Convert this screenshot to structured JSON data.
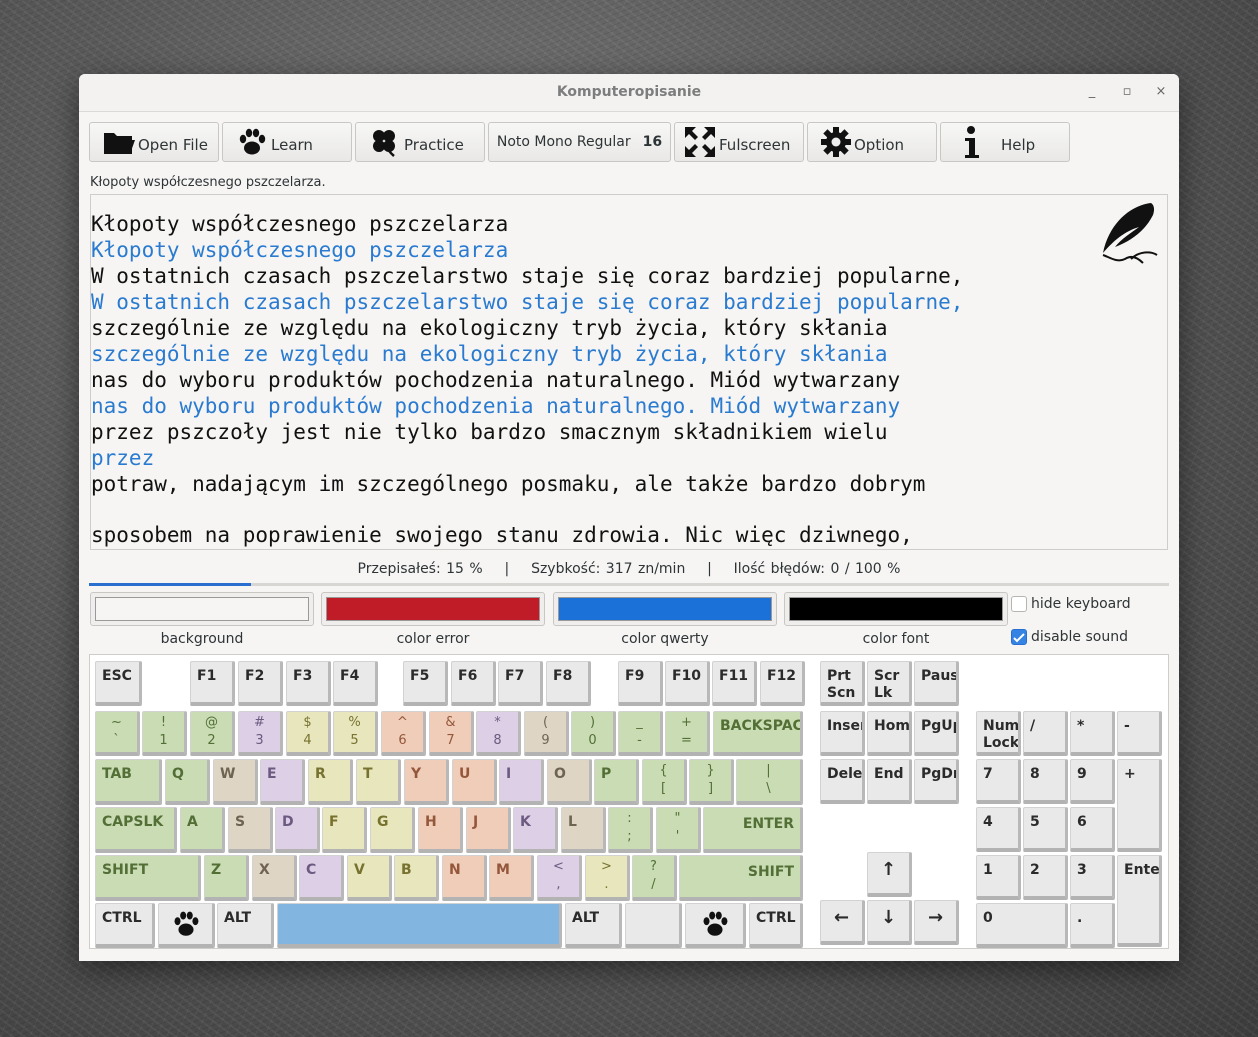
{
  "window": {
    "title": "Komputeropisanie",
    "controls": [
      "_",
      "▫",
      "×"
    ]
  },
  "toolbar": {
    "open": "Open File",
    "learn": "Learn",
    "practice": "Practice",
    "font_name": "Noto Mono Regular",
    "font_size": "16",
    "fullscreen": "Fulscreen",
    "option": "Option",
    "help": "Help"
  },
  "status_text": "Kłopoty współczesnego pszczelarza.",
  "text_lines": [
    {
      "kind": "original",
      "text": "Kłopoty współczesnego pszczelarza"
    },
    {
      "kind": "typed",
      "text": "Kłopoty współczesnego pszczelarza"
    },
    {
      "kind": "original",
      "text": "W ostatnich czasach pszczelarstwo staje się coraz bardziej popularne,"
    },
    {
      "kind": "typed",
      "text": "W ostatnich czasach pszczelarstwo staje się coraz bardziej popularne,"
    },
    {
      "kind": "original",
      "text": "szczególnie ze względu na ekologiczny tryb życia, który skłania"
    },
    {
      "kind": "typed",
      "text": "szczególnie ze względu na ekologiczny tryb życia, który skłania"
    },
    {
      "kind": "original",
      "text": "nas do wyboru produktów pochodzenia naturalnego. Miód wytwarzany"
    },
    {
      "kind": "typed",
      "text": "nas do wyboru produktów pochodzenia naturalnego. Miód wytwarzany"
    },
    {
      "kind": "original",
      "text": "przez pszczoły jest nie tylko bardzo smacznym składnikiem wielu"
    },
    {
      "kind": "typed",
      "text": "przez"
    },
    {
      "kind": "original",
      "text": "potraw, nadającym im szczególnego posmaku, ale także bardzo dobrym"
    },
    {
      "kind": "original",
      "text": "sposobem na poprawienie swojego stanu zdrowia. Nic więc dziwnego,"
    }
  ],
  "stats": {
    "copied": "Przepisałeś: 15 %",
    "speed": "Szybkość: 317 zn/min",
    "errors": "Ilość błędów: 0 / 100 %",
    "separator": "|"
  },
  "progress": 0.15,
  "colors": {
    "background": {
      "label": "background",
      "value": "#f6f5f4"
    },
    "error": {
      "label": "color error",
      "value": "#c01c28"
    },
    "qwerty": {
      "label": "color qwerty",
      "value": "#1c71d8"
    },
    "font": {
      "label": "color font",
      "value": "#000000"
    }
  },
  "options": {
    "hide_keyboard": "hide keyboard",
    "hide_keyboard_checked": false,
    "disable_sound": "disable sound",
    "disable_sound_checked": true
  },
  "keyboard": {
    "esc": "ESC",
    "f": [
      "F1",
      "F2",
      "F3",
      "F4",
      "F5",
      "F6",
      "F7",
      "F8",
      "F9",
      "F10",
      "F11",
      "F12"
    ],
    "num_row": [
      [
        "~",
        "`"
      ],
      [
        "!",
        "1"
      ],
      [
        "@",
        "2"
      ],
      [
        "#",
        "3"
      ],
      [
        "$",
        "4"
      ],
      [
        "%",
        "5"
      ],
      [
        "^",
        "6"
      ],
      [
        "&",
        "7"
      ],
      [
        "*",
        "8"
      ],
      [
        "(",
        "9"
      ],
      [
        ")",
        "0"
      ],
      [
        "_",
        "-"
      ],
      [
        "+",
        "="
      ]
    ],
    "backspace": "BACKSPACE",
    "tab": "TAB",
    "row_q": [
      "Q",
      "W",
      "E",
      "R",
      "T",
      "Y",
      "U",
      "I",
      "O",
      "P"
    ],
    "row_q_sym": [
      [
        "{",
        "["
      ],
      [
        "}",
        "]"
      ],
      [
        "|",
        "\\"
      ]
    ],
    "capslk": "CAPSLK",
    "row_a": [
      "A",
      "S",
      "D",
      "F",
      "G",
      "H",
      "J",
      "K",
      "L"
    ],
    "row_a_sym": [
      [
        ":",
        ";"
      ],
      [
        "\"",
        "'"
      ]
    ],
    "enter": "ENTER",
    "shift": "SHIFT",
    "row_z": [
      "Z",
      "X",
      "C",
      "V",
      "B",
      "N",
      "M"
    ],
    "row_z_sym": [
      [
        "<",
        ","
      ],
      [
        ">",
        "."
      ],
      [
        "?",
        "/"
      ]
    ],
    "ctrl": "CTRL",
    "alt": "ALT",
    "nav": {
      "prtscn": "Prt\nScn",
      "scrlk": "Scr\nLk",
      "pause": "Pause",
      "insert": "Insert",
      "home": "Home",
      "pgup": "PgUp",
      "delete": "Delete",
      "end": "End",
      "pgdn": "PgDn"
    },
    "arrows": {
      "up": "↑",
      "left": "←",
      "down": "↓",
      "right": "→"
    },
    "numpad": {
      "numlock": "Num\nLock",
      "div": "/",
      "mul": "*",
      "minus": "-",
      "plus": "+",
      "enter": "Enter",
      "n7": "7",
      "n8": "8",
      "n9": "9",
      "n4": "4",
      "n5": "5",
      "n6": "6",
      "n1": "1",
      "n2": "2",
      "n3": "3",
      "n0": "0",
      "dot": "."
    }
  }
}
